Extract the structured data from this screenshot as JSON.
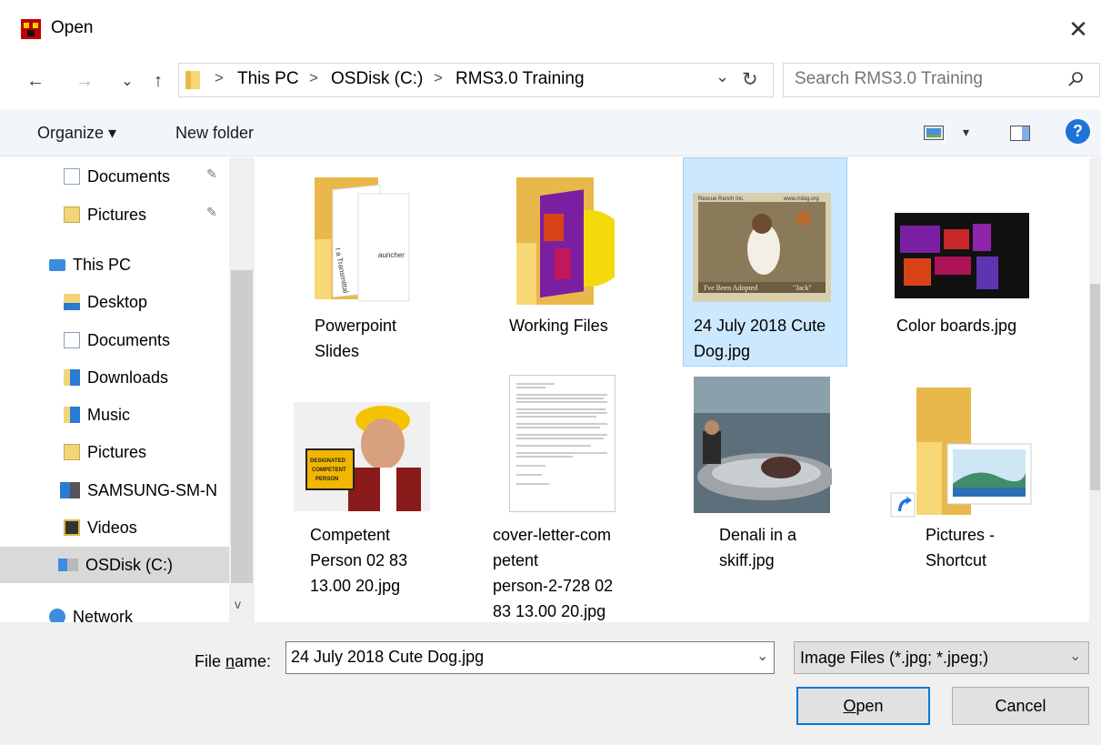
{
  "window": {
    "title": "Open",
    "close_glyph": "✕"
  },
  "nav_buttons": {
    "back": "←",
    "forward": "→",
    "recent": "⌄",
    "up": "↑"
  },
  "address": {
    "crumbs": [
      "This PC",
      "OSDisk (C:)",
      "RMS3.0 Training"
    ],
    "separator": ">",
    "dropdown": "⌄",
    "refresh": "↻"
  },
  "search": {
    "placeholder": "Search RMS3.0 Training"
  },
  "toolbar": {
    "organize": "Organize ▾",
    "new_folder": "New folder",
    "view_arrow": "▾",
    "help": "?"
  },
  "nav_pane": {
    "items": [
      {
        "label": "Documents",
        "pinned": true,
        "icon": "documents-icon"
      },
      {
        "label": "Pictures",
        "pinned": true,
        "icon": "pictures-icon"
      },
      {
        "label": "This PC",
        "icon": "computer-icon"
      },
      {
        "label": "Desktop",
        "icon": "desktop-icon"
      },
      {
        "label": "Documents",
        "icon": "documents-icon"
      },
      {
        "label": "Downloads",
        "icon": "downloads-icon"
      },
      {
        "label": "Music",
        "icon": "music-icon"
      },
      {
        "label": "Pictures",
        "icon": "pictures-icon"
      },
      {
        "label": "SAMSUNG-SM-N",
        "icon": "phone-icon"
      },
      {
        "label": "Videos",
        "icon": "videos-icon"
      },
      {
        "label": "OSDisk (C:)",
        "icon": "drive-icon",
        "selected": true
      },
      {
        "label": "Network",
        "icon": "network-icon"
      }
    ],
    "pin_glyph": "📌"
  },
  "files": [
    {
      "label_lines": [
        "Powerpoint",
        "Slides"
      ],
      "type": "folder"
    },
    {
      "label_lines": [
        "Working Files"
      ],
      "type": "folder"
    },
    {
      "label_lines": [
        "24 July 2018 Cute",
        "Dog.jpg"
      ],
      "type": "image",
      "selected": true
    },
    {
      "label_lines": [
        "Color boards.jpg"
      ],
      "type": "image"
    },
    {
      "label_lines": [
        "Competent",
        "Person 02 83",
        "13.00 20.jpg"
      ],
      "type": "image"
    },
    {
      "label_lines": [
        "cover-letter-com",
        "petent",
        "person-2-728 02",
        "83 13.00 20.jpg"
      ],
      "type": "image"
    },
    {
      "label_lines": [
        "Denali in a",
        "skiff.jpg"
      ],
      "type": "image"
    },
    {
      "label_lines": [
        "Pictures -",
        "Shortcut"
      ],
      "type": "shortcut"
    }
  ],
  "thumb_text": {
    "dog_top_left": "Rescue Ranch Inc.",
    "dog_top_right": "www.rrdog.org",
    "dog_caption": "I've Been Adopted",
    "dog_name": "\"Jack\"",
    "badge": [
      "DESIGNATED",
      "COMPETENT",
      "PERSON"
    ],
    "slide_text_1": "t a Transmittal",
    "slide_text_2": "auncher"
  },
  "bottom": {
    "file_name_label_pre": "File ",
    "file_name_label_u": "n",
    "file_name_label_post": "ame:",
    "file_name_value": "24 July 2018 Cute Dog.jpg",
    "file_type": "Image Files (*.jpg; *.jpeg;)",
    "open_u": "O",
    "open_rest": "pen",
    "cancel": "Cancel"
  }
}
